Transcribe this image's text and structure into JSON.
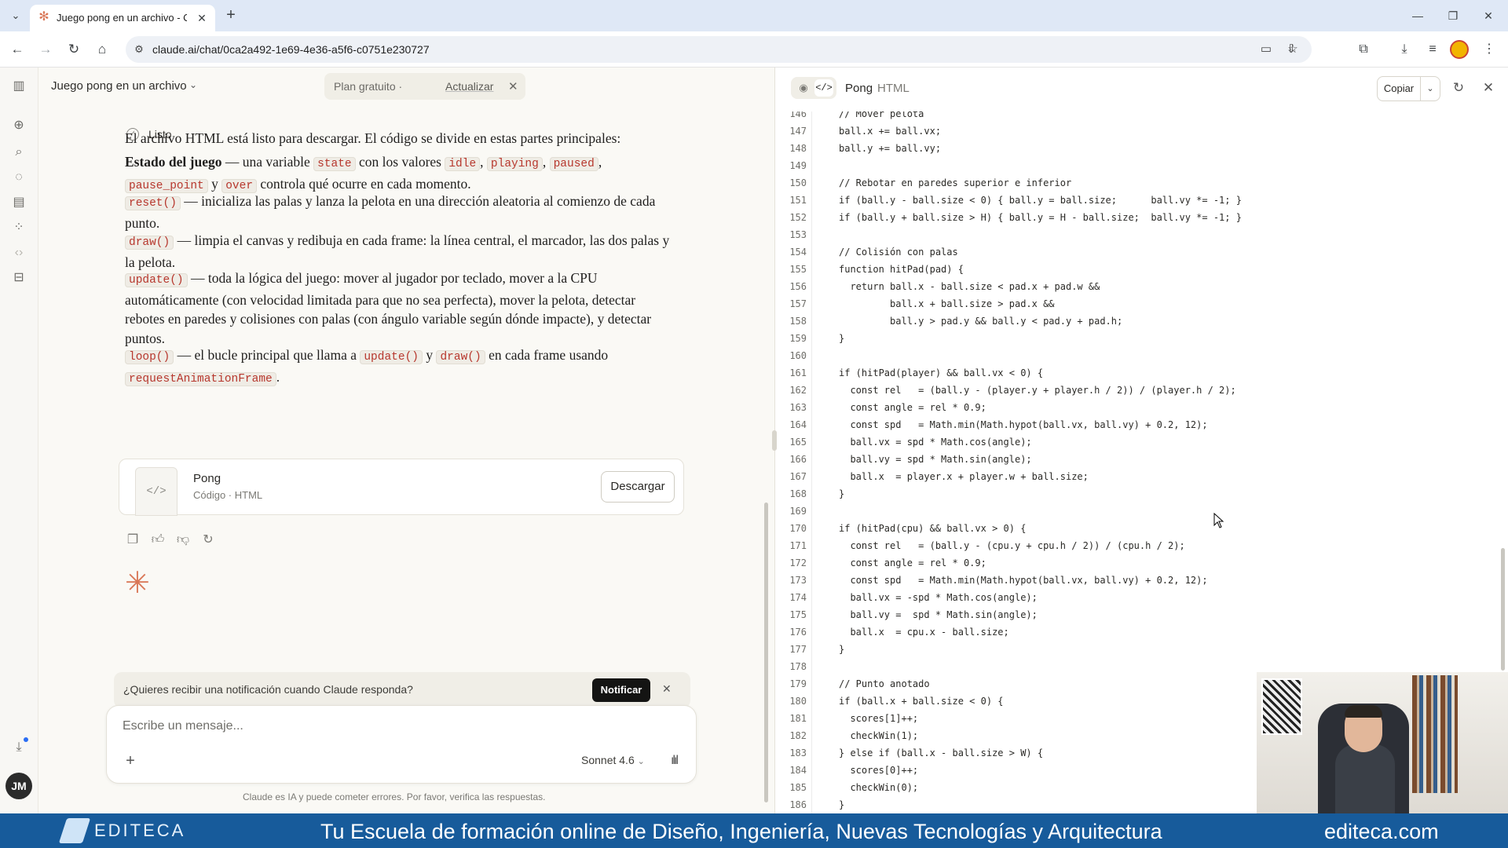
{
  "browser": {
    "tab_title": "Juego pong en un archivo - Cla",
    "url": "claude.ai/chat/0ca2a492-1e69-4e36-a5f6-c0751e230727"
  },
  "rail": {
    "avatar_initials": "JM"
  },
  "chat": {
    "title": "Juego pong en un archivo",
    "plan": {
      "label": "Plan gratuito",
      "separator": "·",
      "link": "Actualizar"
    },
    "status_done": "Listo",
    "messages": {
      "intro": "El archivo HTML está listo para descargar. El código se divide en estas partes principales:",
      "p1": {
        "strong": "Estado del juego",
        "t1": " — una variable ",
        "c1": "state",
        "t2": " con los valores ",
        "c2": "idle",
        "t3": ", ",
        "c3": "playing",
        "t4": ", ",
        "c4": "paused",
        "t5": ", ",
        "c5": "pause_point",
        "t6": " y ",
        "c6": "over",
        "t7": " controla qué ocurre en cada momento."
      },
      "p2": {
        "c1": "reset()",
        "t1": " — inicializa las palas y lanza la pelota en una dirección aleatoria al comienzo de cada punto."
      },
      "p3": {
        "c1": "draw()",
        "t1": " — limpia el canvas y redibuja en cada frame: la línea central, el marcador, las dos palas y la pelota."
      },
      "p4": {
        "c1": "update()",
        "t1": " — toda la lógica del juego: mover al jugador por teclado, mover a la CPU automáticamente (con velocidad limitada para que no sea perfecta), mover la pelota, detectar rebotes en paredes y colisiones con palas (con ángulo variable según dónde impacte), y detectar puntos."
      },
      "p5": {
        "c1": "loop()",
        "t1": " — el bucle principal que llama a ",
        "c2": "update()",
        "t2": " y ",
        "c3": "draw()",
        "t3": " en cada frame usando ",
        "c4": "requestAnimationFrame",
        "t4": "."
      }
    },
    "artifact": {
      "title": "Pong",
      "subtitle": "Código · HTML",
      "download": "Descargar"
    },
    "notification": {
      "text": "¿Quieres recibir una notificación cuando Claude responda?",
      "button": "Notificar"
    },
    "composer": {
      "placeholder": "Escribe un mensaje...",
      "model": "Sonnet 4.6"
    },
    "disclaimer": "Claude es IA y puede cometer errores. Por favor, verifica las respuestas."
  },
  "panel": {
    "title": "Pong",
    "type": "HTML",
    "copy": "Copiar",
    "code_lines": [
      {
        "n": "146",
        "t": "// Mover pelota"
      },
      {
        "n": "147",
        "t": "ball.x += ball.vx;"
      },
      {
        "n": "148",
        "t": "ball.y += ball.vy;"
      },
      {
        "n": "149",
        "t": ""
      },
      {
        "n": "150",
        "t": "// Rebotar en paredes superior e inferior"
      },
      {
        "n": "151",
        "t": "if (ball.y - ball.size < 0) { ball.y = ball.size;      ball.vy *= -1; }"
      },
      {
        "n": "152",
        "t": "if (ball.y + ball.size > H) { ball.y = H - ball.size;  ball.vy *= -1; }"
      },
      {
        "n": "153",
        "t": ""
      },
      {
        "n": "154",
        "t": "// Colisión con palas"
      },
      {
        "n": "155",
        "t": "function hitPad(pad) {"
      },
      {
        "n": "156",
        "t": "  return ball.x - ball.size < pad.x + pad.w &&"
      },
      {
        "n": "157",
        "t": "         ball.x + ball.size > pad.x &&"
      },
      {
        "n": "158",
        "t": "         ball.y > pad.y && ball.y < pad.y + pad.h;"
      },
      {
        "n": "159",
        "t": "}"
      },
      {
        "n": "160",
        "t": ""
      },
      {
        "n": "161",
        "t": "if (hitPad(player) && ball.vx < 0) {"
      },
      {
        "n": "162",
        "t": "  const rel   = (ball.y - (player.y + player.h / 2)) / (player.h / 2);"
      },
      {
        "n": "163",
        "t": "  const angle = rel * 0.9;"
      },
      {
        "n": "164",
        "t": "  const spd   = Math.min(Math.hypot(ball.vx, ball.vy) + 0.2, 12);"
      },
      {
        "n": "165",
        "t": "  ball.vx = spd * Math.cos(angle);"
      },
      {
        "n": "166",
        "t": "  ball.vy = spd * Math.sin(angle);"
      },
      {
        "n": "167",
        "t": "  ball.x  = player.x + player.w + ball.size;"
      },
      {
        "n": "168",
        "t": "}"
      },
      {
        "n": "169",
        "t": ""
      },
      {
        "n": "170",
        "t": "if (hitPad(cpu) && ball.vx > 0) {"
      },
      {
        "n": "171",
        "t": "  const rel   = (ball.y - (cpu.y + cpu.h / 2)) / (cpu.h / 2);"
      },
      {
        "n": "172",
        "t": "  const angle = rel * 0.9;"
      },
      {
        "n": "173",
        "t": "  const spd   = Math.min(Math.hypot(ball.vx, ball.vy) + 0.2, 12);"
      },
      {
        "n": "174",
        "t": "  ball.vx = -spd * Math.cos(angle);"
      },
      {
        "n": "175",
        "t": "  ball.vy =  spd * Math.sin(angle);"
      },
      {
        "n": "176",
        "t": "  ball.x  = cpu.x - ball.size;"
      },
      {
        "n": "177",
        "t": "}"
      },
      {
        "n": "178",
        "t": ""
      },
      {
        "n": "179",
        "t": "// Punto anotado"
      },
      {
        "n": "180",
        "t": "if (ball.x + ball.size < 0) {"
      },
      {
        "n": "181",
        "t": "  scores[1]++;"
      },
      {
        "n": "182",
        "t": "  checkWin(1);"
      },
      {
        "n": "183",
        "t": "} else if (ball.x - ball.size > W) {"
      },
      {
        "n": "184",
        "t": "  scores[0]++;"
      },
      {
        "n": "185",
        "t": "  checkWin(0);"
      },
      {
        "n": "186",
        "t": "}"
      }
    ]
  },
  "banner": {
    "logo": "EDITECA",
    "slogan": "Tu Escuela de formación online de Diseño, Ingeniería, Nuevas Tecnologías y Arquitectura",
    "site": "editeca.com"
  },
  "colors": {
    "accent": "#d97757",
    "banner": "#175b9b",
    "code_inline": "#b7372d"
  },
  "icons": [
    "claude-favicon-icon",
    "search-icon",
    "gear-icon",
    "eye-icon",
    "code-icon",
    "copy-icon",
    "thumbs-up-icon",
    "thumbs-down-icon",
    "retry-icon",
    "close-icon",
    "chevron-down-icon"
  ]
}
